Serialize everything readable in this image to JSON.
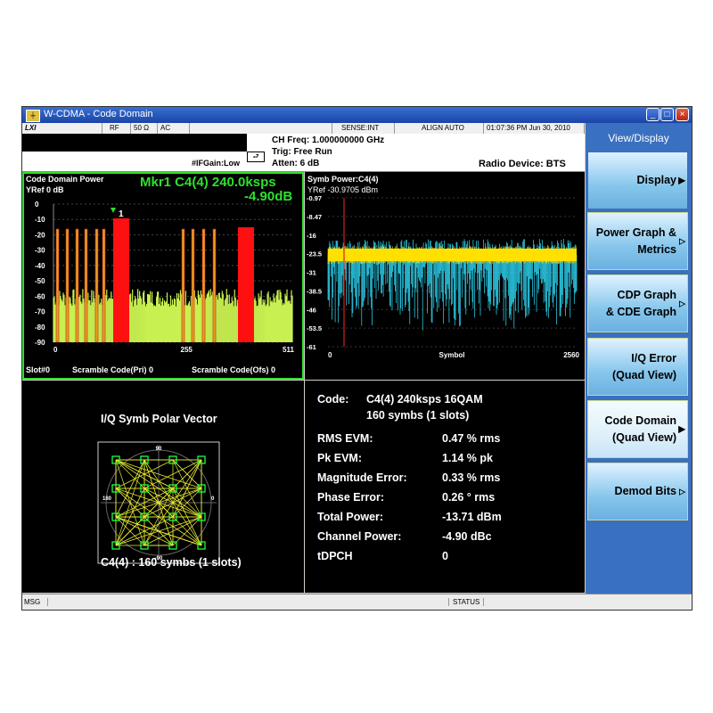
{
  "window": {
    "title": "W-CDMA - Code Domain",
    "icon": "app-icon",
    "controls": [
      "_",
      "□",
      "×"
    ]
  },
  "status_row": {
    "logo": "LXI",
    "rf": "RF",
    "impedance": "50 Ω",
    "coupling": "AC",
    "sense": "SENSE:INT",
    "align": "ALIGN AUTO",
    "timestamp": "01:07:36 PM Jun 30, 2010"
  },
  "info": {
    "ifgain": "#IFGain:Low",
    "ch_freq": "CH Freq: 1.000000000 GHz",
    "trig": "Trig: Free Run",
    "atten": "Atten: 6 dB",
    "radio_device": "Radio Device: BTS"
  },
  "cdp_panel": {
    "title": "Code Domain Power",
    "yref": "YRef  0 dB",
    "marker_line1": "Mkr1 C4(4) 240.0ksps",
    "marker_line2": "-4.90dB",
    "marker_label": "1",
    "x_ticks": [
      "0",
      "255",
      "511"
    ],
    "y_ticks": [
      "0",
      "-10",
      "-20",
      "-30",
      "-40",
      "-50",
      "-60",
      "-70",
      "-80",
      "-90"
    ],
    "footer_slot": "Slot#0",
    "footer_pri": "Scramble Code(Pri) 0",
    "footer_ofs": "Scramble Code(Ofs) 0"
  },
  "symb_panel": {
    "title": "Symb Power:C4(4)",
    "yref": "YRef  -30.9705 dBm",
    "y_ticks": [
      "-0.97",
      "-8.47",
      "-16",
      "-23.5",
      "-31",
      "-38.5",
      "-46",
      "-53.5",
      "-61"
    ],
    "x_start": "0",
    "x_label": "Symbol",
    "x_end": "2560"
  },
  "iq_panel": {
    "title": "I/Q Symb Polar Vector",
    "deg_90": "90",
    "deg_180": "180",
    "deg_0": "0",
    "deg_m90": "-90",
    "caption": "C4(4) : 160 symbs (1 slots)"
  },
  "metrics_panel": {
    "code_label": "Code:",
    "code_value": "C4(4) 240ksps 16QAM",
    "code_value2": "160 symbs (1 slots)",
    "rows": [
      {
        "label": "RMS EVM:",
        "value": "0.47 % rms"
      },
      {
        "label": "Pk EVM:",
        "value": "1.14 % pk"
      },
      {
        "label": "Magnitude Error:",
        "value": "0.33 % rms"
      },
      {
        "label": "Phase Error:",
        "value": "0.26 ° rms"
      },
      {
        "label": "Total Power:",
        "value": "-13.71 dBm"
      },
      {
        "label": "Channel Power:",
        "value": "-4.90 dBc"
      },
      {
        "label": "tDPCH",
        "value": "0"
      }
    ]
  },
  "softkeys": {
    "menu_title": "View/Display",
    "display": "Display",
    "power_graph_1": "Power Graph &",
    "power_graph_2": "Metrics",
    "cdp_graph_1": "CDP Graph",
    "cdp_graph_2": "& CDE Graph",
    "iq_error_1": "I/Q Error",
    "iq_error_2": "(Quad View)",
    "code_domain_1": "Code Domain",
    "code_domain_2": "(Quad View)",
    "demod_bits": "Demod Bits",
    "arrow_filled": "▶",
    "arrow_open": "▷"
  },
  "bottom": {
    "msg": "MSG",
    "status": "STATUS"
  },
  "colors": {
    "accent_green": "#2ee02e",
    "cdp_noise": "#c8f050",
    "cdp_bar_red": "#ff1010",
    "cdp_bar_orange": "#e8a020",
    "symb_cyan": "#30e0ff",
    "symb_yellow": "#ffe000",
    "constellation": "#e8e830",
    "constellation_points": "#20ff40",
    "softkey_panel": "#3a70c0"
  }
}
